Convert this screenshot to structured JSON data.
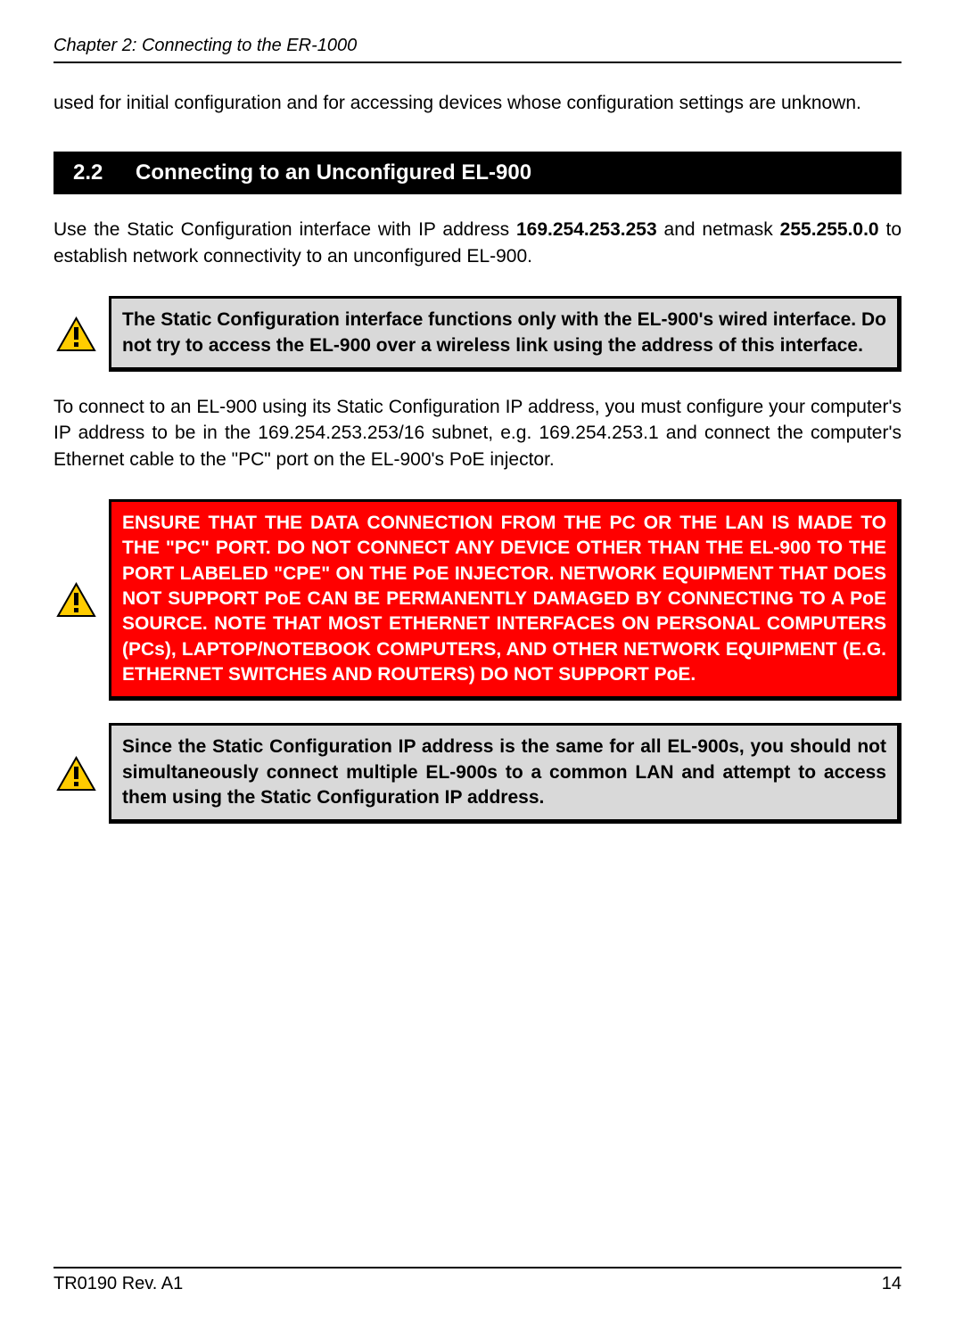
{
  "header": {
    "chapter": "Chapter 2: Connecting to the ER-1000"
  },
  "intro_text": "used for initial configuration and for accessing devices whose configuration settings are unknown.",
  "section": {
    "number": "2.2",
    "title": "Connecting to an Unconfigured EL-900"
  },
  "para1_prefix": "Use the Static Configuration interface with IP address ",
  "para1_ip": "169.254.253.253",
  "para1_mid": " and netmask ",
  "para1_mask": "255.255.0.0",
  "para1_suffix": " to establish network connectivity to an unconfigured EL-900.",
  "callout1": "The Static Configuration interface functions only with the EL-900's wired interface. Do not try to access the EL-900 over a wireless link using the address of this interface.",
  "para2": "To connect to an EL-900 using its Static Configuration IP address, you must configure your computer's IP address to be in the 169.254.253.253/16 subnet, e.g. 169.254.253.1 and connect the computer's Ethernet cable to the \"PC\" port on the EL-900's PoE injector.",
  "callout2": "ENSURE THAT THE DATA CONNECTION FROM THE PC OR THE LAN IS MADE TO THE \"PC\" PORT. DO NOT CONNECT ANY DEVICE OTHER THAN THE EL-900 TO THE PORT LABELED \"CPE\" ON THE PoE INJECTOR. NETWORK EQUIPMENT THAT DOES NOT SUPPORT PoE CAN BE PERMANENTLY DAMAGED BY CONNECTING TO A PoE SOURCE. NOTE THAT MOST ETHERNET INTERFACES ON PERSONAL COMPUTERS (PCs), LAPTOP/NOTEBOOK COMPUTERS, AND OTHER NETWORK EQUIPMENT (E.G. ETHERNET SWITCHES AND ROUTERS) DO NOT SUPPORT PoE.",
  "callout3": "Since the Static Configuration IP address is the same for all EL-900s, you should not simultaneously connect multiple EL-900s to a common LAN and attempt to access them using the Static Configuration IP address.",
  "footer": {
    "left": "TR0190 Rev. A1",
    "right": "14"
  }
}
